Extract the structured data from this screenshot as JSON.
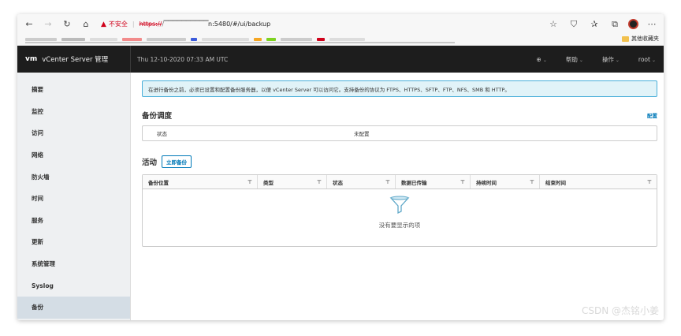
{
  "browser": {
    "insecure_label": "不安全",
    "url_scheme": "https://",
    "url_host_obscured": "/▔▔▔▔▔▔▔▔▔▔",
    "url_rest": "n:5480/#/ui/backup",
    "bookmark_folder": "其他收藏夹"
  },
  "header": {
    "logo": "vm",
    "title": "vCenter Server 管理",
    "datetime": "Thu 12-10-2020 07:33 AM UTC",
    "globe_caret": "⌄",
    "help": "帮助",
    "actions": "操作",
    "user": "root"
  },
  "sidebar": {
    "items": [
      {
        "label": "摘要"
      },
      {
        "label": "监控"
      },
      {
        "label": "访问"
      },
      {
        "label": "网络"
      },
      {
        "label": "防火墙"
      },
      {
        "label": "时间"
      },
      {
        "label": "服务"
      },
      {
        "label": "更新"
      },
      {
        "label": "系统管理"
      },
      {
        "label": "Syslog"
      },
      {
        "label": "备份"
      }
    ],
    "active_index": 10
  },
  "main": {
    "alert": "在进行备份之前，必须已设置和配置备份服务器，以便 vCenter Server 可以访问它。支持备份的协议为 FTPS、HTTPS、SFTP、FTP、NFS、SMB 和 HTTP。",
    "schedule_title": "备份调度",
    "configure_link": "配置",
    "schedule_key": "状态",
    "schedule_value": "未配置",
    "activity_title": "活动",
    "backup_now": "立即备份",
    "columns": [
      "备份位置",
      "类型",
      "状态",
      "数据已传输",
      "持续时间",
      "结束时间"
    ],
    "empty_text": "没有要显示的项"
  },
  "watermark": "CSDN @杰铭小姜",
  "colors": {
    "header_bg": "#1d1d1d",
    "accent": "#0079b8",
    "alert_bg": "#e1f3f8",
    "alert_border": "#49afd9",
    "sidebar_bg": "#eef0f2",
    "active_bg": "#d4dde5",
    "insecure": "#d0021b"
  }
}
